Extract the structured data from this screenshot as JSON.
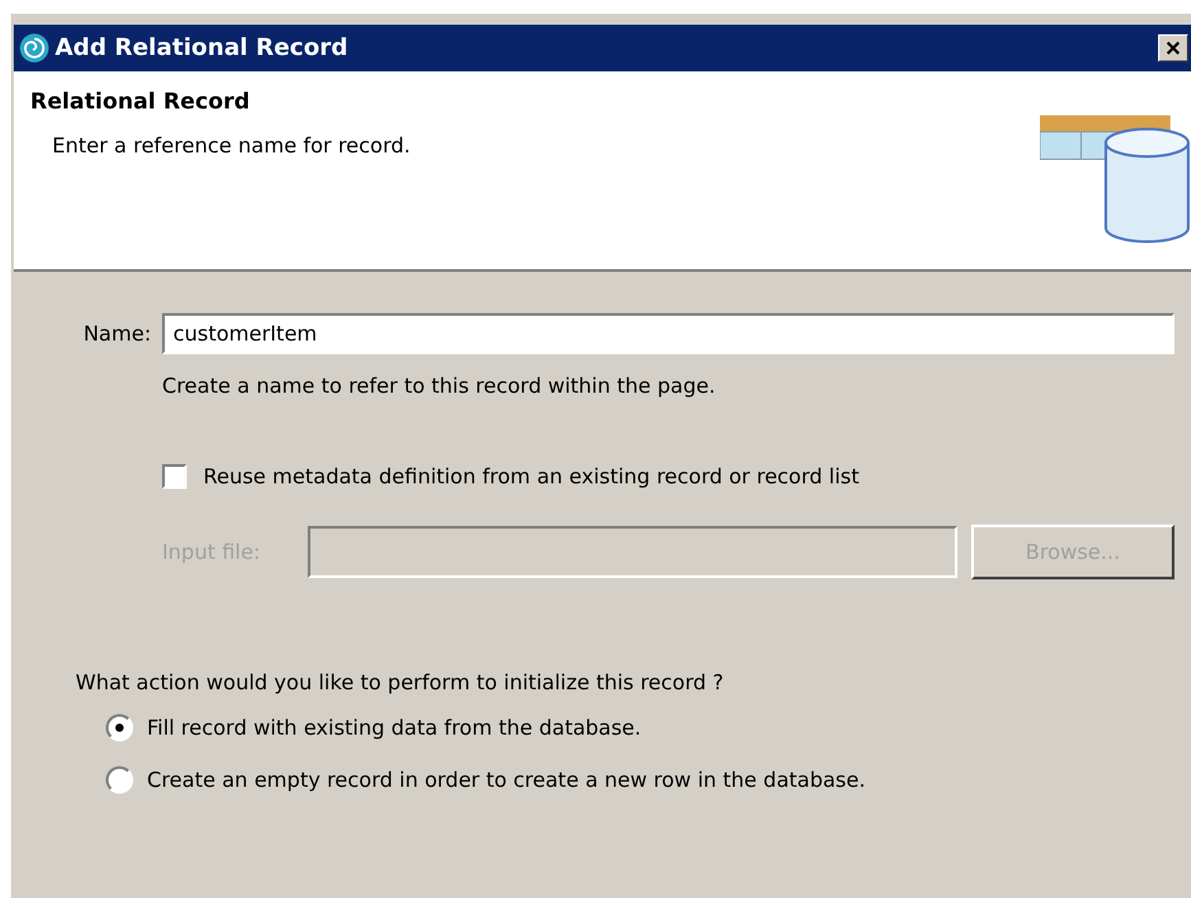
{
  "window": {
    "title": "Add Relational Record"
  },
  "header": {
    "title": "Relational Record",
    "description": "Enter a reference name for record."
  },
  "name_field": {
    "label": "Name:",
    "value": "customerItem",
    "hint": "Create a name to refer to this record within the page."
  },
  "reuse": {
    "label": "Reuse metadata definition from an existing record or record list",
    "checked": false
  },
  "input_file": {
    "label": "Input file:",
    "disabled": true,
    "button": "Browse..."
  },
  "action": {
    "question": "What action would you like to perform to initialize this record ?",
    "options": [
      {
        "label": "Fill record with existing data from the database.",
        "selected": true
      },
      {
        "label": "Create an empty record in order to create a new row in the database.",
        "selected": false
      }
    ]
  }
}
